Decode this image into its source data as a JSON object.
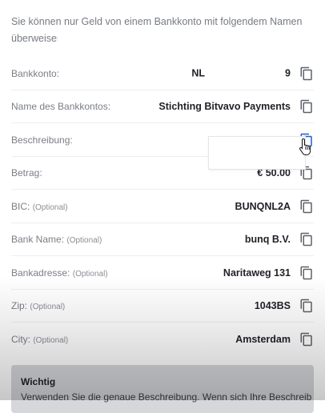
{
  "intro": {
    "line1": "Sie können nur Geld von einem Bankkonto mit folgendem Namen",
    "line2": "überweisen"
  },
  "rows": [
    {
      "label": "Bankkonto:",
      "optional": "",
      "value_start": "NL",
      "value_end": "9"
    },
    {
      "label": "Name des Bankkontos:",
      "optional": "",
      "value": "Stichting Bitvavo Payments"
    },
    {
      "label": "Beschreibung:",
      "optional": "",
      "value": ""
    },
    {
      "label": "Betrag:",
      "optional": "",
      "value": "€ 50.00"
    },
    {
      "label": "BIC:",
      "optional": "(Optional)",
      "value": "BUNQNL2A"
    },
    {
      "label": "Bank Name:",
      "optional": "(Optional)",
      "value": "bunq B.V."
    },
    {
      "label": "Bankadresse:",
      "optional": "(Optional)",
      "value": "Naritaweg 131"
    },
    {
      "label": "Zip:",
      "optional": "(Optional)",
      "value": "1043BS"
    },
    {
      "label": "City:",
      "optional": "(Optional)",
      "value": "Amsterdam"
    }
  ],
  "notice": {
    "title": "Wichtig",
    "text": "Verwenden Sie die genaue Beschreibung. Wenn sich Ihre Beschreibung von der"
  },
  "icons": {
    "copy": "copy-icon",
    "cursor": "hand-pointer-icon"
  },
  "colors": {
    "copy_icon": "#5c6169",
    "copy_icon_active": "#1d5fd6"
  }
}
